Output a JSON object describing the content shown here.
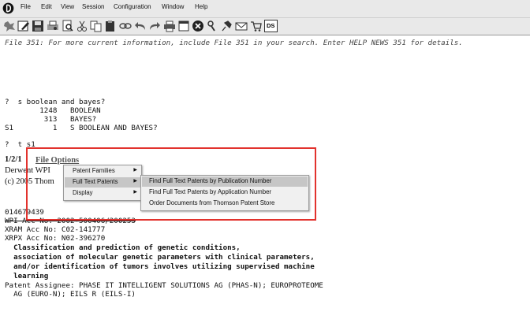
{
  "menubar": {
    "items": [
      "File",
      "Edit",
      "View",
      "Session",
      "Configuration",
      "Window",
      "Help"
    ]
  },
  "toolbar": {
    "buttons": [
      "new-icon",
      "edit-icon",
      "save-icon",
      "print-preview-icon",
      "find-icon",
      "cut-icon",
      "copy-icon",
      "paste-icon",
      "link-icon",
      "undo-icon",
      "redo-icon",
      "printer-icon",
      "window-icon",
      "stop-icon",
      "tools-icon",
      "pin-icon",
      "mail-icon",
      "cart-icon"
    ],
    "ds_label": "DS"
  },
  "session": {
    "lines": [
      "File 351: For more current information, include File 351 in your search. Enter HELP NEWS 351 for details.",
      "?  s boolean and bayes?",
      "        1248   BOOLEAN",
      "         313   BAYES?",
      "S1         1   S BOOLEAN AND BAYES?",
      "?  t s1",
      "1/2/1",
      "Derwent WPI",
      "(c) 2005 Thom",
      "014679439",
      "WPI Acc No: 2002-500406/200253",
      "XRAM Acc No: C02-141777",
      "XRPX Acc No: N02-396270",
      "  Classification and prediction of genetic conditions,",
      "  association of molecular genetic parameters with clinical parameters,",
      "  and/or identification of tumors involves utilizing supervised machine",
      "  learning",
      "Patent Assignee: PHASE IT INTELLIGENT SOLUTIONS AG (PHAS-N); EUROPROTEOME",
      "  AG (EURO-N); EILS R (EILS-I)"
    ],
    "file_options": "File Options"
  },
  "context_menu": {
    "items": [
      "Patent Families",
      "Full Text Patents",
      "Display"
    ],
    "highlighted": "Full Text Patents"
  },
  "submenu": {
    "items": [
      "Find Full Text Patents by Publication Number",
      "Find Full Text Patents by Application Number",
      "Order Documents from Thomson Patent Store"
    ],
    "highlighted": "Find Full Text Patents by Publication Number"
  },
  "colors": {
    "highlight_box": "#e2322d",
    "menu_highlight": "#c6c6c6"
  }
}
